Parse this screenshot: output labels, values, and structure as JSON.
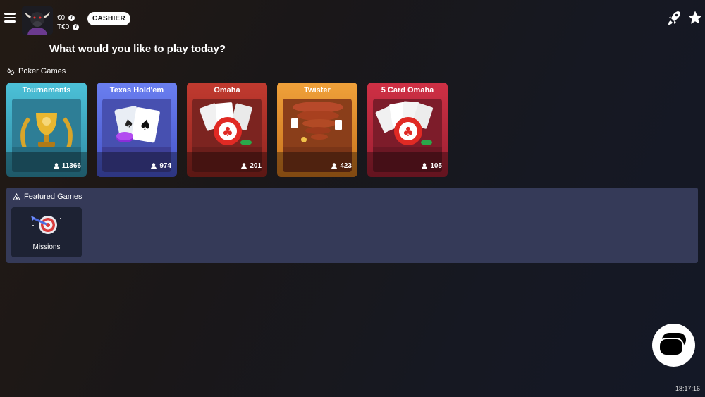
{
  "header": {
    "menu_icon": "hamburger-menu-icon",
    "avatar_icon": "bull-avatar-icon",
    "balance_cash": "€0",
    "balance_tickets": "T€0",
    "cashier_label": "CASHIER",
    "rocket_icon": "rocket-icon",
    "favorites_icon": "star-icon"
  },
  "headline": "What would you like to play today?",
  "poker_section": {
    "title": "Poker Games",
    "games": [
      {
        "name": "Tournaments",
        "players": "11366",
        "color": "#46b3cc"
      },
      {
        "name": "Texas Hold'em",
        "players": "974",
        "color": "#5868df"
      },
      {
        "name": "Omaha",
        "players": "201",
        "color": "#b63028"
      },
      {
        "name": "Twister",
        "players": "423",
        "color": "#de8a22"
      },
      {
        "name": "5 Card Omaha",
        "players": "105",
        "color": "#c4283a"
      }
    ]
  },
  "featured_section": {
    "title": "Featured Games",
    "items": [
      {
        "name": "Missions",
        "icon": "target-dart-icon"
      }
    ]
  },
  "chat_icon": "chat-bubbles-icon",
  "clock": "18:17:16",
  "colors": {
    "panel": "#353a58",
    "tile": "#1d2233"
  }
}
